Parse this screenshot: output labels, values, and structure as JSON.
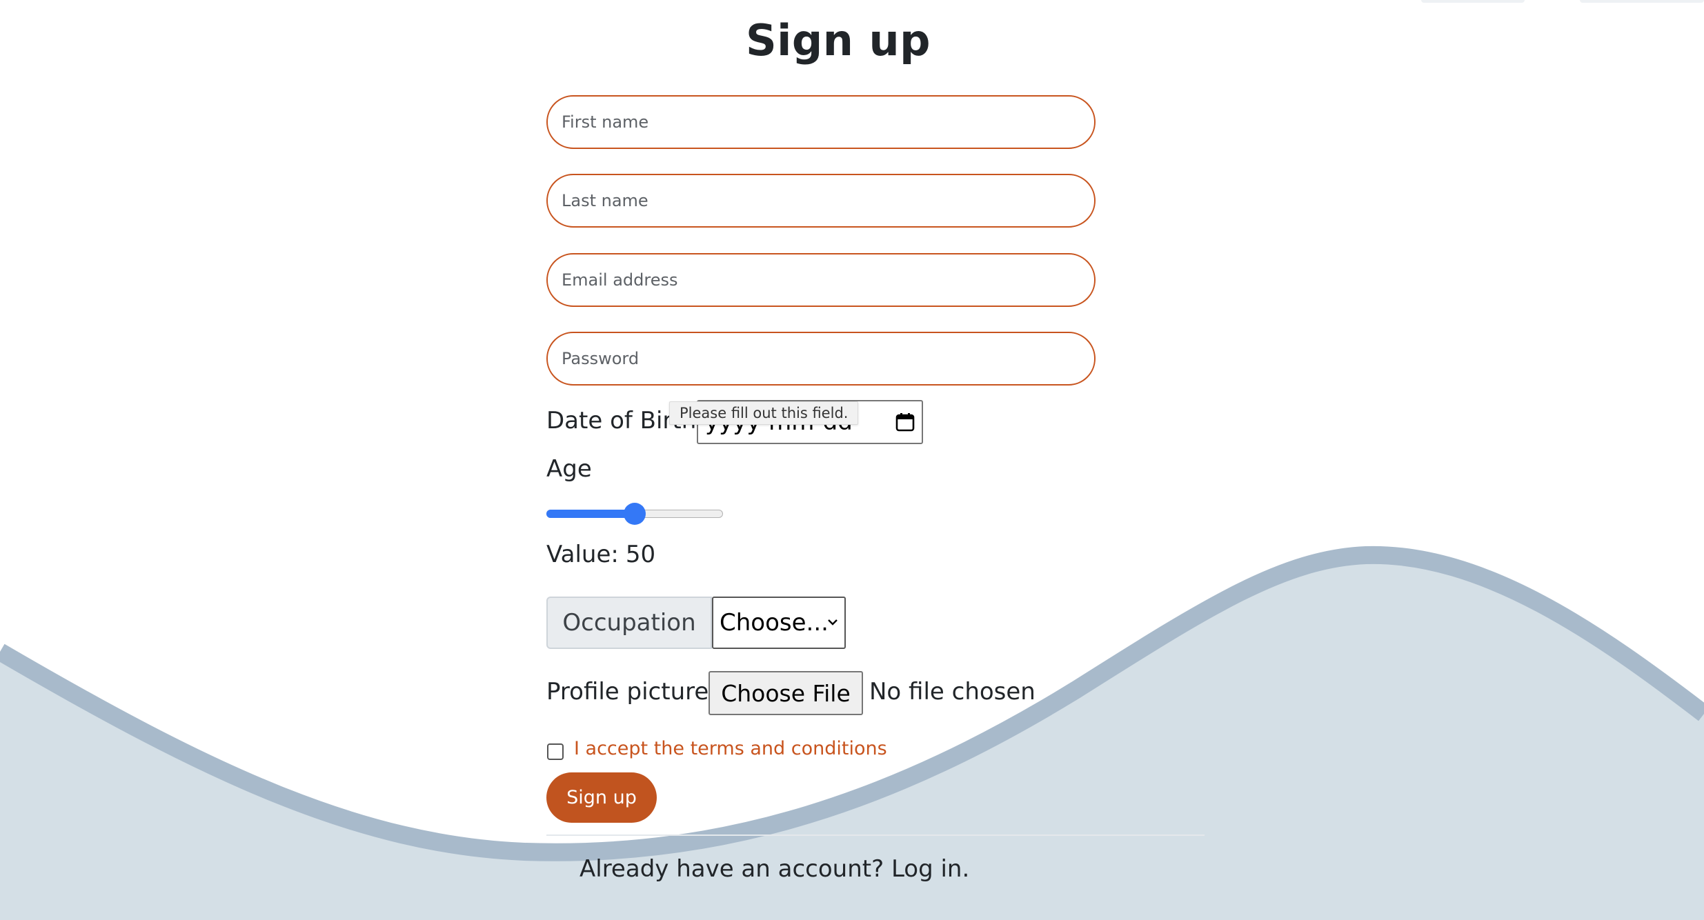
{
  "page": {
    "title": "Sign up"
  },
  "form": {
    "first_name_placeholder": "First name",
    "last_name_placeholder": "Last name",
    "email_placeholder": "Email address",
    "password_placeholder": "Password",
    "dob_label": "Date of Birth",
    "dob_value": "yyyy-mm-dd",
    "validation_tooltip": "Please fill out this field.",
    "age_label": "Age",
    "age_value": 50,
    "age_min": 0,
    "age_max": 100,
    "value_label": "Value:",
    "value_number": "50",
    "occupation_label": "Occupation",
    "occupation_selected": "Choose...",
    "profile_picture_label": "Profile picture",
    "file_button_label": "Choose File",
    "file_status": "No file chosen",
    "terms_label": "I accept the terms and conditions",
    "terms_checked": false,
    "submit_label": "Sign up"
  },
  "footer": {
    "prompt": "Already have an account?",
    "login_link": "Log in."
  },
  "colors": {
    "accent": "#c8541e",
    "slider": "#3478f6",
    "wave_light": "#d4dfe6",
    "wave_dark": "#a8bacb"
  },
  "icons": {
    "date_picker": "calendar-icon",
    "select_arrow": "chevron-down-icon"
  }
}
